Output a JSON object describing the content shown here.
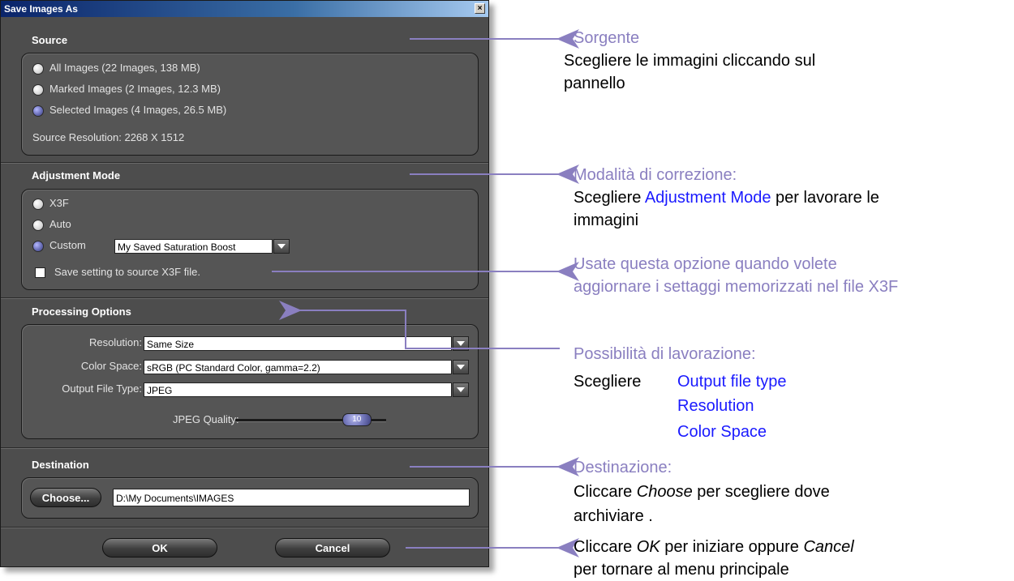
{
  "dialog": {
    "title": "Save Images As",
    "close_glyph": "×",
    "source": {
      "title": "Source",
      "options": [
        {
          "label": "All Images  (22 Images, 138 MB)",
          "selected": false
        },
        {
          "label": "Marked Images  (2 Images, 12.3 MB)",
          "selected": false
        },
        {
          "label": "Selected Images  (4 Images, 26.5 MB)",
          "selected": true
        }
      ],
      "resolution_label": "Source Resolution:",
      "resolution_value": "2268 X 1512"
    },
    "adjustment": {
      "title": "Adjustment Mode",
      "options": [
        {
          "label": "X3F",
          "selected": false
        },
        {
          "label": "Auto",
          "selected": false
        },
        {
          "label": "Custom",
          "selected": true
        }
      ],
      "custom_value": "My Saved Saturation Boost",
      "save_setting_label": "Save setting to source X3F file.",
      "save_setting_checked": false
    },
    "processing": {
      "title": "Processing Options",
      "resolution_label": "Resolution:",
      "resolution_value": "Same Size",
      "color_space_label": "Color Space:",
      "color_space_value": "sRGB (PC Standard Color, gamma=2.2)",
      "file_type_label": "Output File Type:",
      "file_type_value": "JPEG",
      "jpeg_quality_label": "JPEG Quality:",
      "jpeg_quality_value": "10",
      "jpeg_quality_fraction": 0.8
    },
    "destination": {
      "title": "Destination",
      "choose_label": "Choose...",
      "path": "D:\\My Documents\\IMAGES"
    },
    "ok_label": "OK",
    "cancel_label": "Cancel"
  },
  "annotations": {
    "source": {
      "title": "Sorgente",
      "line1": "Scegliere le immagini cliccando sul",
      "line2": "pannello"
    },
    "adjustment": {
      "title": "Modalità di correzione:",
      "line1_a": "Scegliere ",
      "line1_link": "Adjustment Mode",
      "line1_b": " per lavorare le",
      "line2": "immagini"
    },
    "save_setting": {
      "line1": "Usate questa opzione quando volete",
      "line2": "aggiornare i settaggi memorizzati nel file X3F"
    },
    "processing": {
      "title": "Possibilità di lavorazione:",
      "lead": "Scegliere",
      "links": [
        "Output file type",
        "Resolution",
        "Color Space"
      ]
    },
    "destination": {
      "title": "Destinazione:",
      "line1_a": "Cliccare ",
      "line1_em": "Choose",
      "line1_b": " per scegliere dove",
      "line2": "archiviare ."
    },
    "buttons": {
      "line1_a": "Cliccare ",
      "line1_em1": "OK",
      "line1_b": " per iniziare oppure ",
      "line1_em2": "Cancel",
      "line2": "per tornare al menu principale"
    }
  },
  "colors": {
    "accent": "#8a7fc0",
    "link": "#1a1aff",
    "dialog_bg": "#4d4d4d"
  }
}
